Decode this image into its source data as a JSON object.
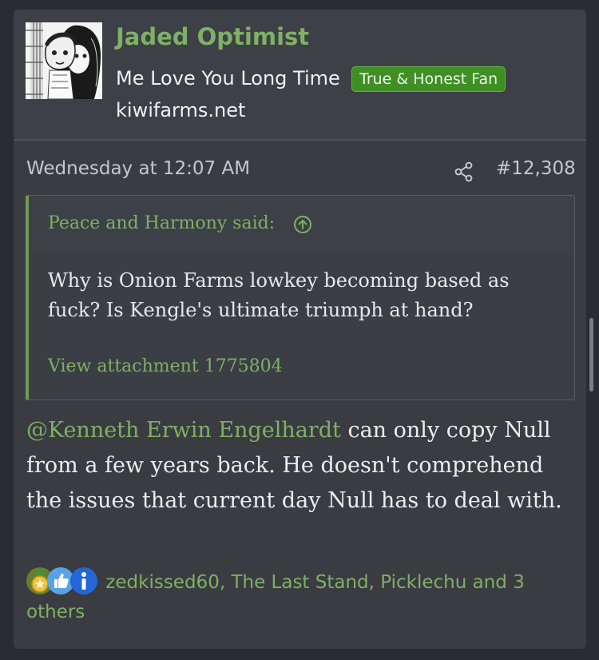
{
  "post": {
    "author": {
      "username": "Jaded Optimist",
      "user_title": "Me Love You Long Time",
      "banner": "True & Honest Fan",
      "site": "kiwifarms.net",
      "avatar_icon": "avatar-image"
    },
    "timestamp": "Wednesday at 12:07 AM",
    "post_number": "#12,308",
    "share_icon": "share-icon",
    "quote": {
      "attribution": "Peace and Harmony said:",
      "jump_icon": "arrow-up-circle-icon",
      "text": "Why is Onion Farms lowkey becoming based as fuck? Is Kengle's ultimate triumph at hand?",
      "attachment_link": "View attachment 1775804"
    },
    "body": {
      "mention": "@Kenneth Erwin Engelhardt",
      "text": " can only copy Null from a few years back. He doesn't comprehend the issues that current day Null has to deal with."
    },
    "reactions": {
      "icons": [
        "winner-icon",
        "like-icon",
        "informative-icon"
      ],
      "list_text": "zedkissed60, The Last Stand, Picklechu and 3 others"
    }
  },
  "colors": {
    "accent_green": "#7fb064",
    "banner_green": "#3f8f24",
    "card_bg": "#3a3c42",
    "page_bg": "#2a2c31"
  }
}
